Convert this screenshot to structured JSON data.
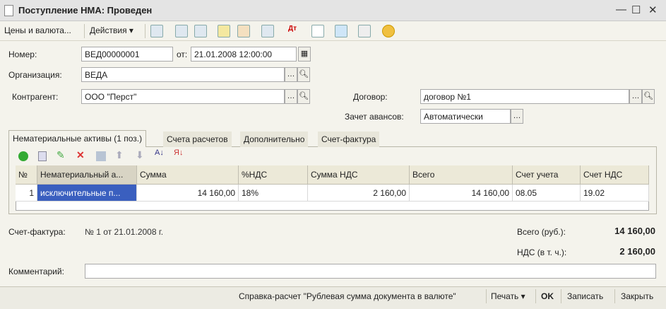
{
  "window": {
    "title": "Поступление НМА: Проведен"
  },
  "toolbar": {
    "prices": "Цены и валюта...",
    "actions": "Действия ▾"
  },
  "form": {
    "number_label": "Номер:",
    "number": "ВЕД00000001",
    "date_label": "от:",
    "date": "21.01.2008 12:00:00",
    "org_label": "Организация:",
    "org": "ВЕДА",
    "contractor_label": "Контрагент:",
    "contractor": "ООО \"Перст\"",
    "contract_label": "Договор:",
    "contract": "договор №1",
    "advance_label": "Зачет авансов:",
    "advance": "Автоматически"
  },
  "tabs": [
    "Нематериальные активы (1 поз.)",
    "Счета расчетов",
    "Дополнительно",
    "Счет-фактура"
  ],
  "table": {
    "columns": [
      "№",
      "Нематериальный а...",
      "Сумма",
      "%НДС",
      "Сумма НДС",
      "Всего",
      "Счет учета",
      "Счет НДС"
    ],
    "rows": [
      [
        "1",
        "исключительные п...",
        "14 160,00",
        "18%",
        "2 160,00",
        "14 160,00",
        "08.05",
        "19.02"
      ]
    ]
  },
  "summary": {
    "invoice_label": "Счет-фактура:",
    "invoice": "№ 1 от 21.01.2008 г.",
    "total_label": "Всего (руб.):",
    "total": "14 160,00",
    "vat_label": "НДС (в т. ч.):",
    "vat": "2 160,00",
    "comment_label": "Комментарий:",
    "comment": ""
  },
  "footer": {
    "report": "Справка-расчет \"Рублевая сумма документа в валюте\"",
    "print": "Печать ▾",
    "ok": "OK",
    "save": "Записать",
    "close": "Закрыть"
  }
}
